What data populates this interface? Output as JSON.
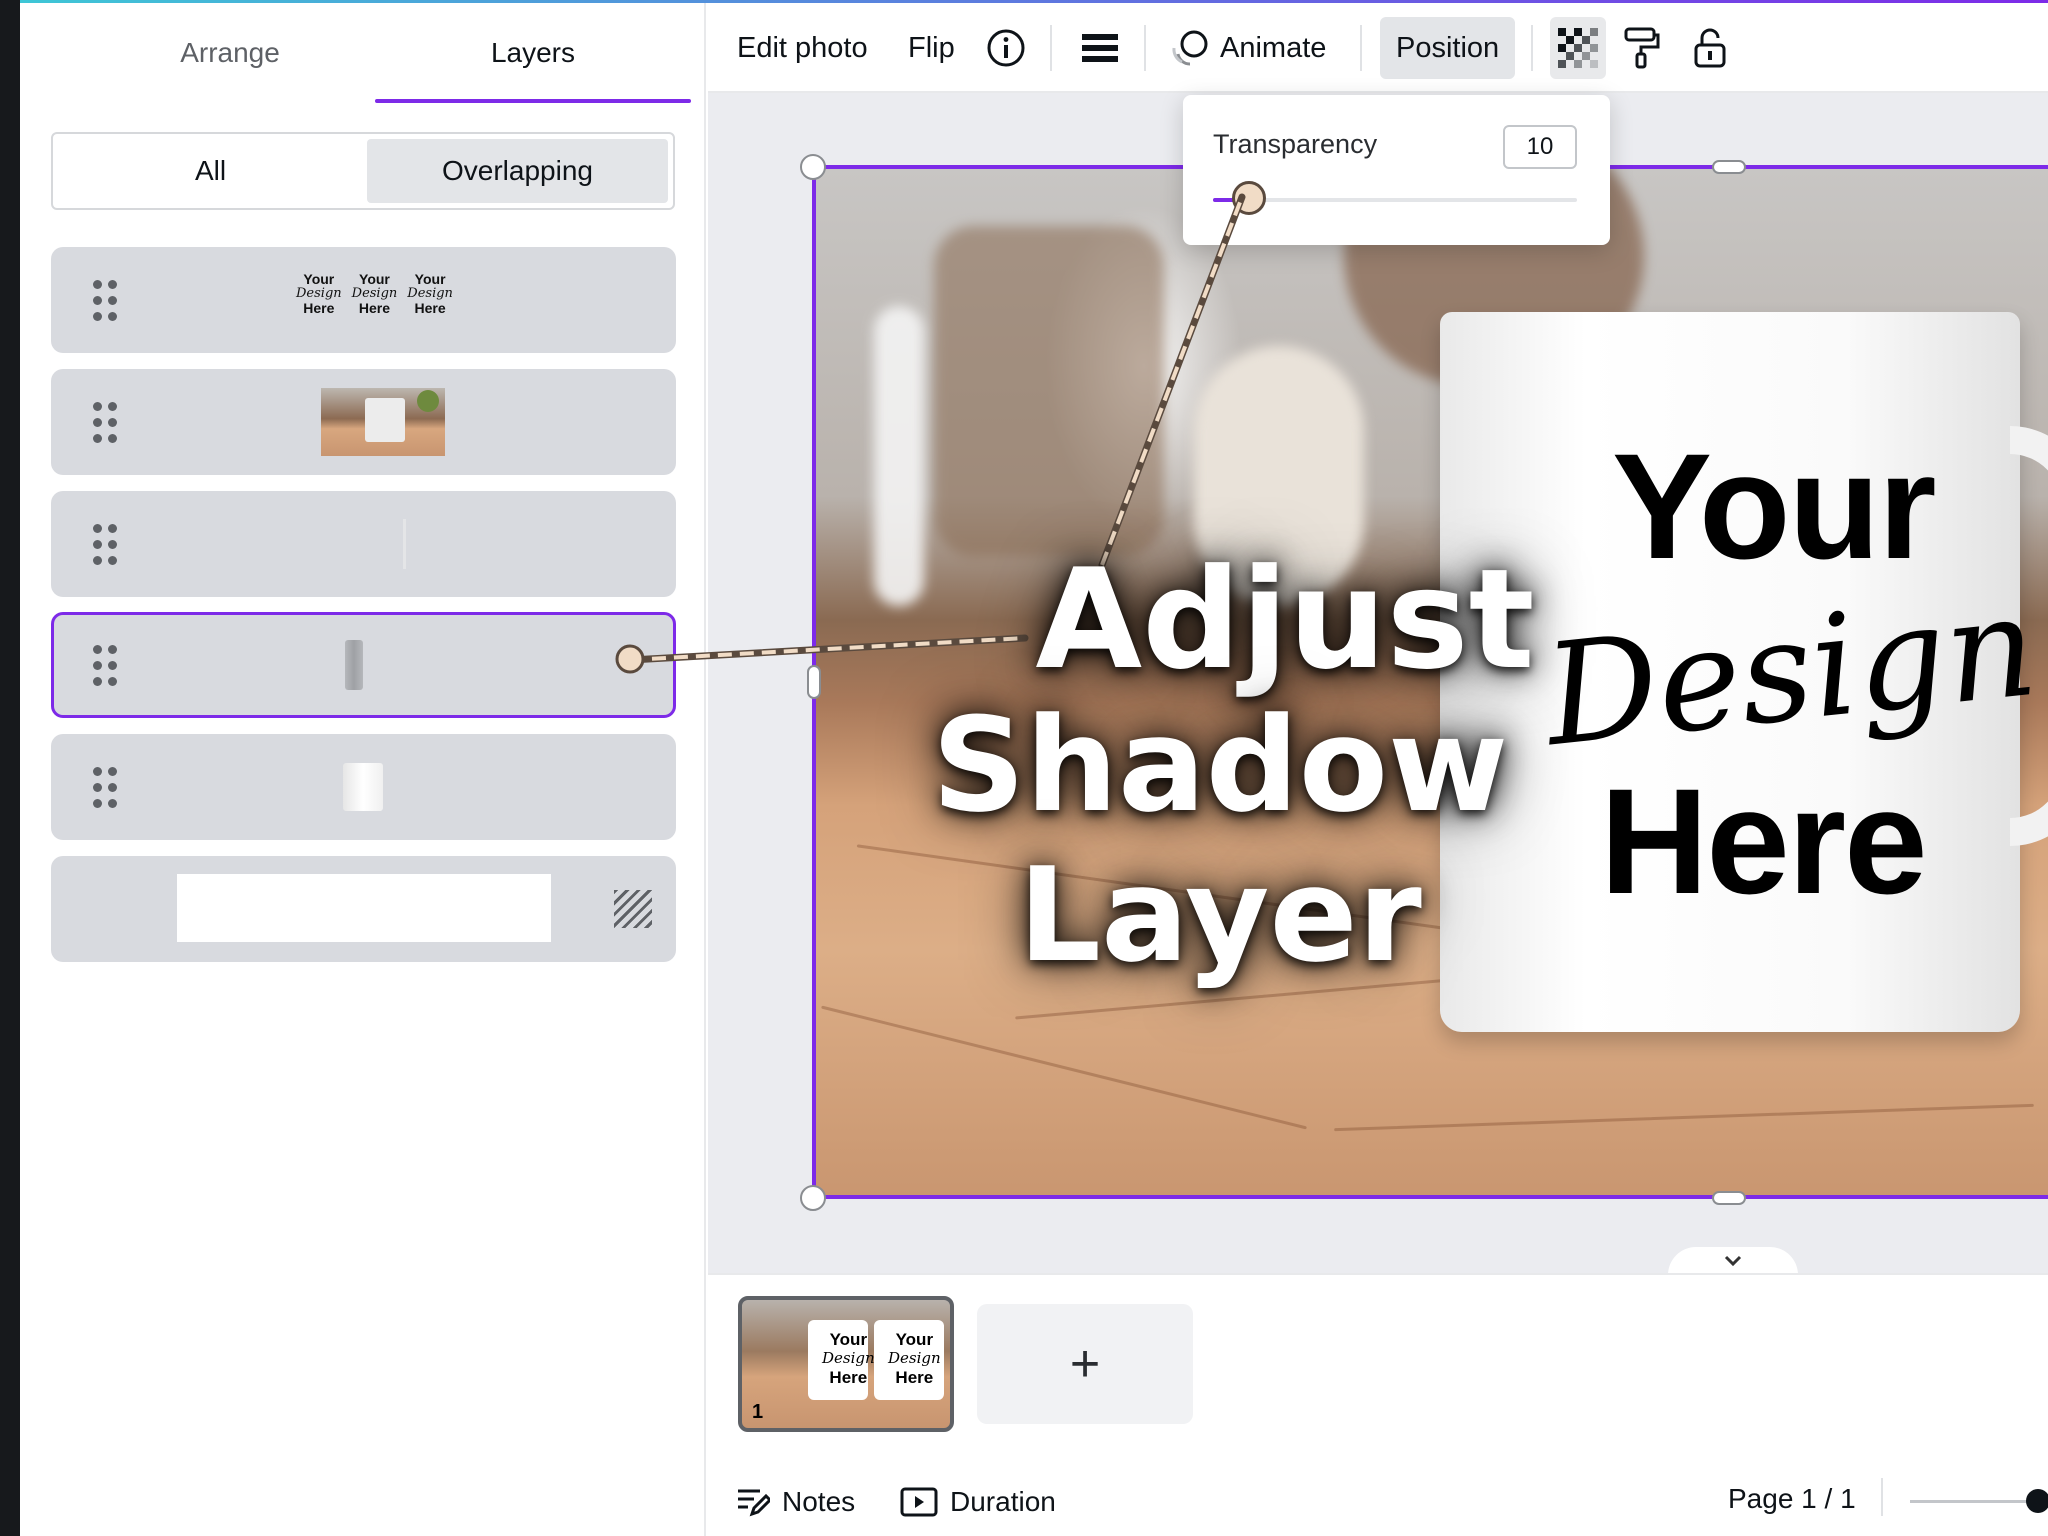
{
  "panel": {
    "tabs": [
      {
        "label": "Arrange",
        "active": false
      },
      {
        "label": "Layers",
        "active": true
      }
    ],
    "filter": {
      "all_label": "All",
      "overlapping_label": "Overlapping",
      "selected": "Overlapping"
    },
    "layers": [
      {
        "name": "text-layer",
        "thumb_words": [
          "Your",
          "Design",
          "Here"
        ]
      },
      {
        "name": "photo-layer"
      },
      {
        "name": "line-layer"
      },
      {
        "name": "shadow-layer",
        "selected": true
      },
      {
        "name": "highlight-layer"
      },
      {
        "name": "background-layer"
      }
    ]
  },
  "toolbar": {
    "edit_photo": "Edit photo",
    "flip": "Flip",
    "info_icon": "info-icon",
    "menu_icon": "lines-icon",
    "animate": "Animate",
    "position": "Position",
    "transparency_icon": "checkerboard-icon",
    "paint_icon": "paint-roller-icon",
    "lock_icon": "unlock-icon"
  },
  "popover": {
    "label": "Transparency",
    "value": "10",
    "slider_fraction": 0.1
  },
  "canvas": {
    "mug_text": {
      "line1": "Your",
      "line2": "Design",
      "line3": "Here"
    },
    "headline": {
      "line1": "Adjust",
      "line2": "Shadow Layer"
    }
  },
  "pages": {
    "thumb_number": "1",
    "thumb_words": [
      "Your",
      "Design",
      "Here"
    ],
    "add_label": "+",
    "collapse_icon": "chevron-down-icon"
  },
  "footer": {
    "notes": "Notes",
    "duration": "Duration",
    "page_indicator": "Page 1 / 1"
  },
  "colors": {
    "accent": "#7d2ae8",
    "row_bg": "#d8dadf"
  }
}
